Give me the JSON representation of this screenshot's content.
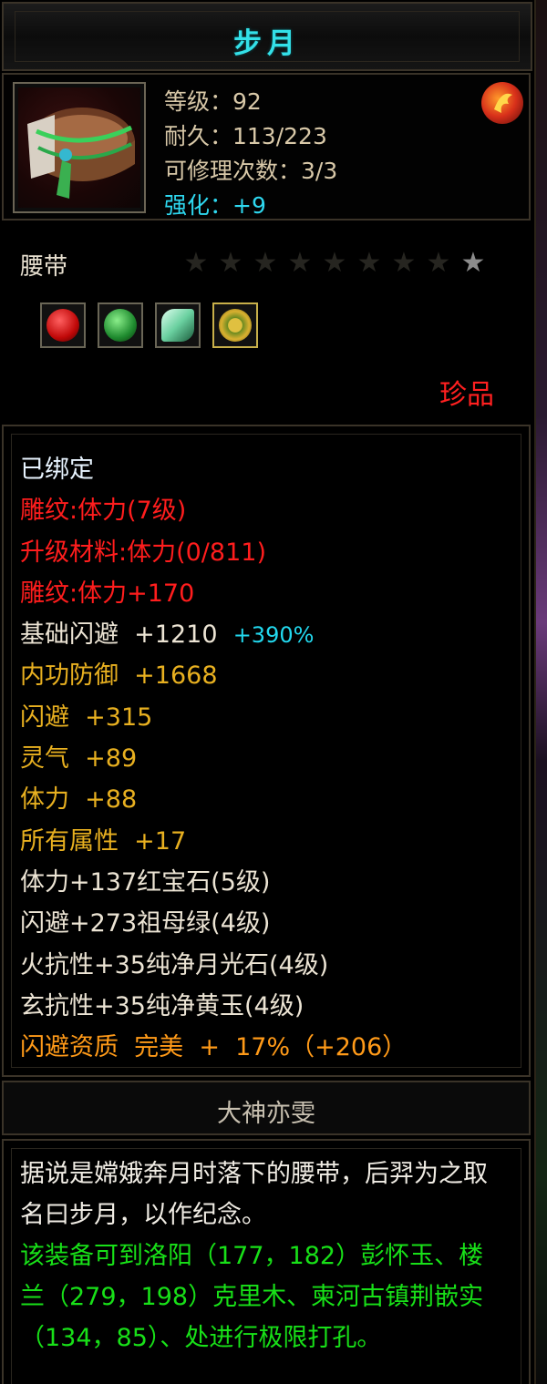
{
  "item": {
    "title": "步月",
    "level": "等级：92",
    "durability": "耐久：113/223",
    "repairs": "可修理次数：3/3",
    "enhance": "强化：+9",
    "name": "腰带",
    "stars_total": 9,
    "stars_lit": 1,
    "rarity": "珍品",
    "gems": [
      "ruby-gem-icon",
      "emerald-gem-icon",
      "moonstone-gem-icon",
      "jade-gem-icon"
    ]
  },
  "attributes": [
    {
      "text": "已绑定",
      "color": "bind"
    },
    {
      "text": "雕纹:体力(7级)",
      "color": "red"
    },
    {
      "text": "升级材料:体力(0/811)",
      "color": "red"
    },
    {
      "text": "雕纹:体力+170",
      "color": "red"
    },
    {
      "text": "基础闪避  +1210",
      "extra": "+390%",
      "color": "white"
    },
    {
      "text": "内功防御  +1668",
      "color": "gold"
    },
    {
      "text": "闪避  +315",
      "color": "gold"
    },
    {
      "text": "灵气  +89",
      "color": "gold"
    },
    {
      "text": "体力  +88",
      "color": "gold"
    },
    {
      "text": "所有属性  +17",
      "color": "gold"
    },
    {
      "text": "体力+137红宝石(5级)",
      "color": "white"
    },
    {
      "text": "闪避+273祖母绿(4级)",
      "color": "white"
    },
    {
      "text": "火抗性+35纯净月光石(4级)",
      "color": "white"
    },
    {
      "text": "玄抗性+35纯净黄玉(4级)",
      "color": "white"
    },
    {
      "text": "闪避资质  完美  +  17%（+206）",
      "color": "orange"
    }
  ],
  "maker": "大神亦雯",
  "description": {
    "lore": "据说是嫦娥奔月时落下的腰带，后羿为之取名曰步月，以作纪念。",
    "hint": "该装备可到洛阳（177，182）彭怀玉、楼兰（279，198）克里木、柬河古镇荆嵌实（134，85）、处进行极限打孔。"
  },
  "colors": {
    "title": "#33e0e8",
    "red": "#ff1d1d",
    "gold": "#e8b020",
    "cyan": "#22d8ee",
    "orange": "#ff9a18",
    "green": "#18e018"
  }
}
